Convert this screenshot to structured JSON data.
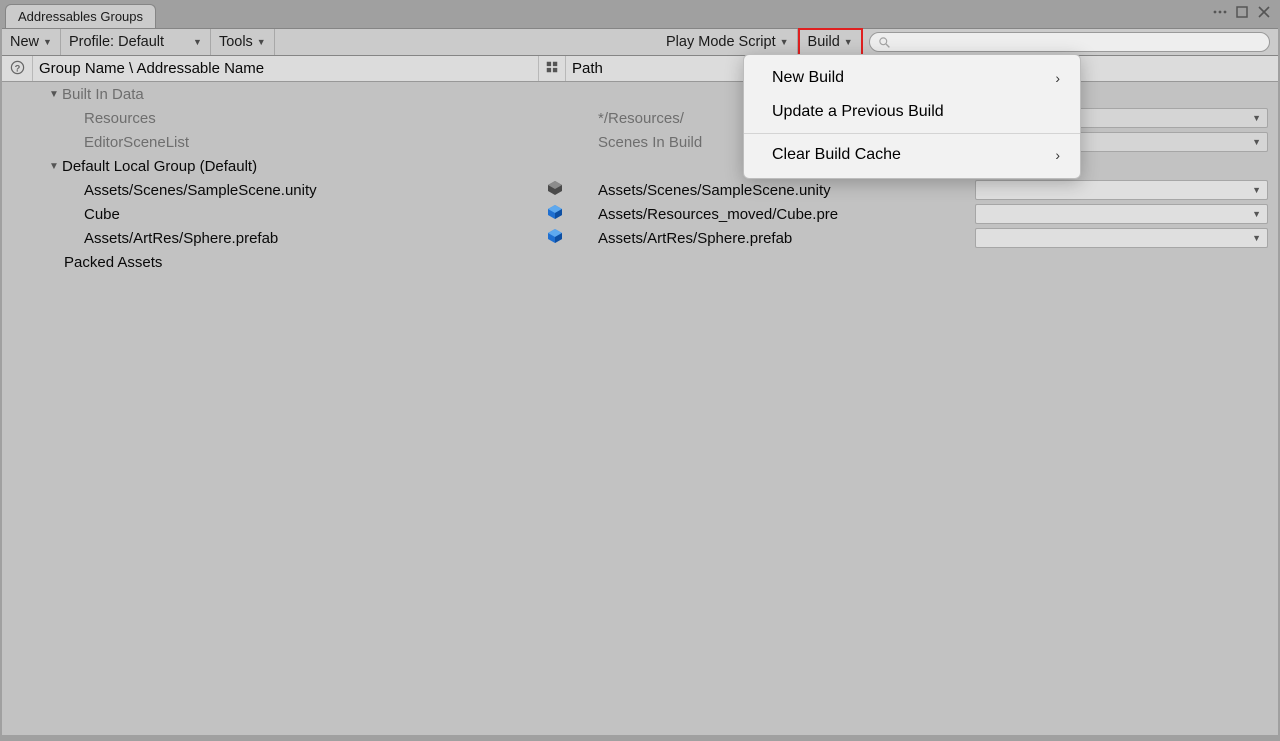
{
  "window": {
    "title": "Addressables Groups"
  },
  "toolbar": {
    "new": "New",
    "profile_label": "Profile:",
    "profile_value": "Default",
    "tools": "Tools",
    "playmode": "Play Mode Script",
    "build": "Build"
  },
  "columns": {
    "name": "Group Name \\ Addressable Name",
    "path": "Path"
  },
  "tree": {
    "builtin": {
      "label": "Built In Data",
      "rows": [
        {
          "name": "Resources",
          "path": "*/Resources/"
        },
        {
          "name": "EditorSceneList",
          "path": "Scenes In Build"
        }
      ]
    },
    "defaultGroup": {
      "label": "Default Local Group (Default)",
      "rows": [
        {
          "name": "Assets/Scenes/SampleScene.unity",
          "path": "Assets/Scenes/SampleScene.unity",
          "icon": "scene"
        },
        {
          "name": "Cube",
          "path": "Assets/Resources_moved/Cube.pre",
          "icon": "prefab"
        },
        {
          "name": "Assets/ArtRes/Sphere.prefab",
          "path": "Assets/ArtRes/Sphere.prefab",
          "icon": "prefab"
        }
      ]
    },
    "packed": {
      "label": "Packed Assets"
    }
  },
  "menu": {
    "new_build": "New Build",
    "update": "Update a Previous Build",
    "clear": "Clear Build Cache"
  },
  "search": {
    "placeholder": ""
  }
}
